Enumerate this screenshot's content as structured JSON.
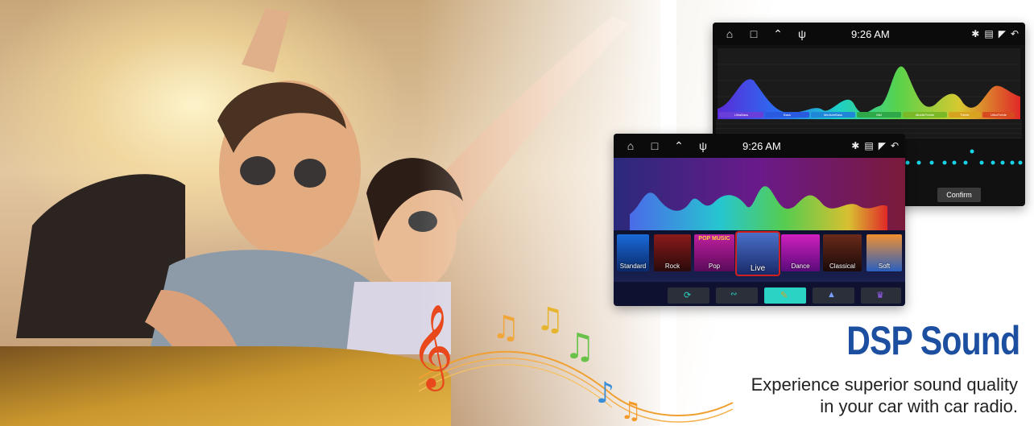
{
  "screen_back": {
    "time": "9:26 AM",
    "bands": [
      "UltraBass",
      "Bass",
      "MediumBass",
      "Mid",
      "MiddleTreble",
      "Treble",
      "UltraTreble"
    ],
    "confirm_label": "Confirm"
  },
  "screen_front": {
    "time": "9:26 AM",
    "presets": [
      "Standard",
      "Rock",
      "Pop",
      "Live",
      "Dance",
      "Classical",
      "Soft"
    ],
    "preset_banner": "POP MUSIC"
  },
  "headline": "DSP Sound",
  "subline_1": "Experience superior sound quality",
  "subline_2": "in your car with car radio.",
  "colors": {
    "title": "#1d4fa0",
    "accent_teal": "#2ad3c3"
  }
}
